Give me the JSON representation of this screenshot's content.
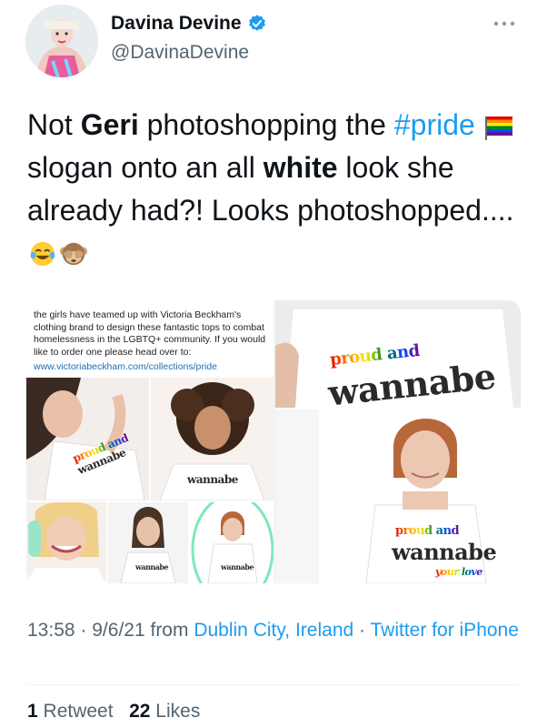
{
  "author": {
    "display_name": "Davina Devine",
    "handle": "@DavinaDevine",
    "verified": true
  },
  "tweet": {
    "part1": "Not ",
    "bold1": "Geri",
    "part2": " photoshopping the ",
    "hashtag": "#pride",
    "part3": " slogan onto an all ",
    "bold2": "white",
    "part4": " look she already had?! Looks photoshopped...."
  },
  "media": {
    "caption": "the girls have teamed up with Victoria Beckham's clothing brand to design these fantastic tops to combat homelessness in the LGBTQ+ community. If you would like to order one please head over to:",
    "link": "www.victoriabeckham.com/collections/pride",
    "shirt_line1": "proud and",
    "shirt_line2": "wannabe",
    "shirt_line3": "your love"
  },
  "meta": {
    "time": "13:58",
    "date": "9/6/21",
    "from_label": "from",
    "location": "Dublin City, Ireland",
    "source": "Twitter for iPhone",
    "separator": "·"
  },
  "stats": {
    "retweets": "1",
    "retweets_label": "Retweet",
    "likes": "22",
    "likes_label": "Likes"
  },
  "colors": {
    "link_blue": "#1d9bf0",
    "secondary": "#536471",
    "highlight_circle": "#7ee8b8"
  },
  "icons": [
    "verified-badge-icon",
    "more-options-icon",
    "rainbow-flag-emoji",
    "tears-of-joy-emoji",
    "see-no-evil-monkey-emoji"
  ]
}
